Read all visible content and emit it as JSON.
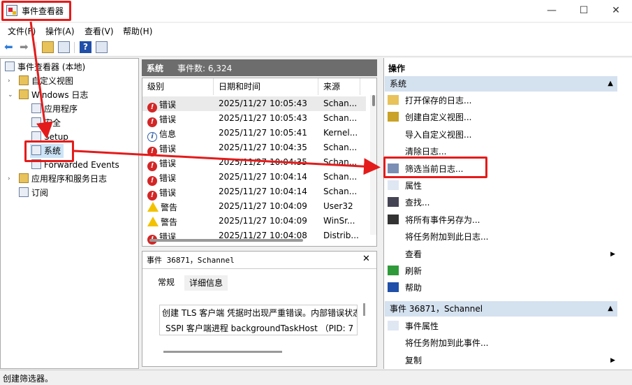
{
  "window": {
    "title": "事件查看器",
    "min": "—",
    "max": "☐",
    "close": "✕"
  },
  "menu": [
    "文件(F)",
    "操作(A)",
    "查看(V)",
    "帮助(H)"
  ],
  "tree": {
    "root": "事件查看器 (本地)",
    "custom_views": "自定义视图",
    "windows_logs": "Windows 日志",
    "items": [
      "应用程序",
      "安全",
      "Setup",
      "系统",
      "Forwarded Events"
    ],
    "apps_services": "应用程序和服务日志",
    "subscriptions": "订阅"
  },
  "list": {
    "header_name": "系统",
    "header_count": "事件数: 6,324",
    "columns": [
      "级别",
      "日期和时间",
      "来源"
    ],
    "rows": [
      {
        "level": "错误",
        "type": "err",
        "time": "2025/11/27 10:05:43",
        "source": "Schan..."
      },
      {
        "level": "错误",
        "type": "err",
        "time": "2025/11/27 10:05:43",
        "source": "Schan..."
      },
      {
        "level": "信息",
        "type": "info",
        "time": "2025/11/27 10:05:41",
        "source": "Kernel..."
      },
      {
        "level": "错误",
        "type": "err",
        "time": "2025/11/27 10:04:35",
        "source": "Schan..."
      },
      {
        "level": "错误",
        "type": "err",
        "time": "2025/11/27 10:04:35",
        "source": "Schan..."
      },
      {
        "level": "错误",
        "type": "err",
        "time": "2025/11/27 10:04:14",
        "source": "Schan..."
      },
      {
        "level": "错误",
        "type": "err",
        "time": "2025/11/27 10:04:14",
        "source": "Schan..."
      },
      {
        "level": "警告",
        "type": "warn",
        "time": "2025/11/27 10:04:09",
        "source": "User32"
      },
      {
        "level": "警告",
        "type": "warn",
        "time": "2025/11/27 10:04:09",
        "source": "WinSr..."
      },
      {
        "level": "错误",
        "type": "err",
        "time": "2025/11/27 10:04:08",
        "source": "Distrib..."
      }
    ]
  },
  "detail": {
    "title": "事件 36871，Schannel",
    "close": "✕",
    "tabs": [
      "常规",
      "详细信息"
    ],
    "lines": [
      "创建 TLS 客户端 凭据时出现严重错误。内部错误状态",
      "SSPI 客户端进程 backgroundTaskHost （PID:  7"
    ]
  },
  "actions": {
    "header": "操作",
    "sec1": "系统",
    "sec1_items": [
      "打开保存的日志...",
      "创建自定义视图...",
      "导入自定义视图...",
      "清除日志...",
      "筛选当前日志...",
      "属性",
      "查找...",
      "将所有事件另存为...",
      "将任务附加到此日志...",
      "查看",
      "刷新",
      "帮助"
    ],
    "sec2": "事件 36871，Schannel",
    "sec2_items": [
      "事件属性",
      "将任务附加到此事件...",
      "复制"
    ]
  },
  "status": "创建筛选器。",
  "colors": {
    "annotation": "#e41b1b",
    "section": "#d4e1ef",
    "header": "#6d6d6d"
  }
}
